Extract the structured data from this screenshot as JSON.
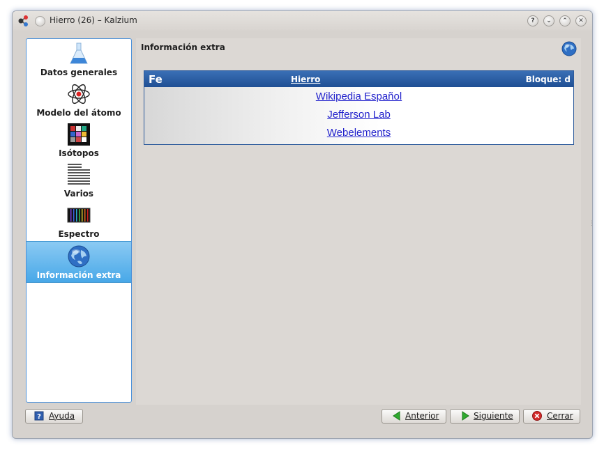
{
  "window": {
    "title": "Hierro (26) – Kalzium"
  },
  "sidebar": {
    "items": [
      {
        "label": "Datos generales",
        "icon": "flask-icon"
      },
      {
        "label": "Modelo del átomo",
        "icon": "atom-icon"
      },
      {
        "label": "Isótopos",
        "icon": "isotope-grid-icon"
      },
      {
        "label": "Varios",
        "icon": "misc-lines-icon"
      },
      {
        "label": "Espectro",
        "icon": "spectrum-icon"
      },
      {
        "label": "Información extra",
        "icon": "globe-icon",
        "selected": true
      }
    ]
  },
  "main": {
    "title": "Información extra",
    "element": {
      "symbol": "Fe",
      "name": "Hierro",
      "block": "Bloque: d"
    },
    "links": [
      "Wikipedia Español",
      "Jefferson Lab",
      "Webelements"
    ]
  },
  "buttons": {
    "help": "Ayuda",
    "previous": "Anterior",
    "next": "Siguiente",
    "close": "Cerrar"
  },
  "colors": {
    "accent": "#48a8e8",
    "header_blue": "#1f4f94",
    "link": "#2222cc"
  }
}
